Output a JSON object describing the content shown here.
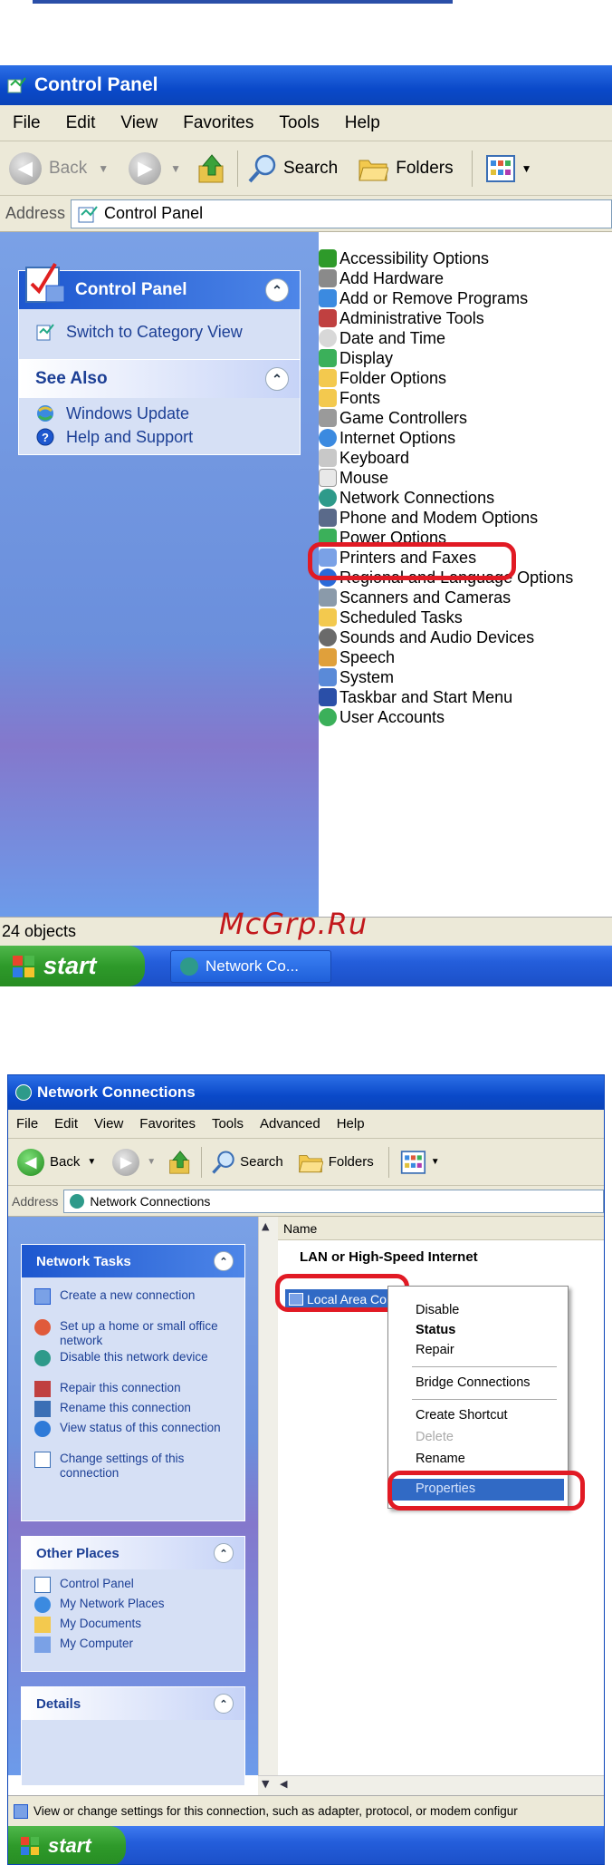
{
  "window1": {
    "title": "Control Panel",
    "menu": [
      "File",
      "Edit",
      "View",
      "Favorites",
      "Tools",
      "Help"
    ],
    "toolbar": {
      "back": "Back",
      "search": "Search",
      "folders": "Folders"
    },
    "address_label": "Address",
    "address_value": "Control Panel",
    "control_panel_box": {
      "title": "Control Panel",
      "link": "Switch to Category View"
    },
    "see_also_box": {
      "title": "See Also",
      "links": [
        "Windows Update",
        "Help and Support"
      ]
    },
    "items": [
      "Accessibility Options",
      "Add Hardware",
      "Add or Remove Programs",
      "Administrative Tools",
      "Date and Time",
      "Display",
      "Folder Options",
      "Fonts",
      "Game Controllers",
      "Internet Options",
      "Keyboard",
      "Mouse",
      "Network Connections",
      "Phone and Modem Options",
      "Power Options",
      "Printers and Faxes",
      "Regional and Language Options",
      "Scanners and Cameras",
      "Scheduled Tasks",
      "Sounds and Audio Devices",
      "Speech",
      "System",
      "Taskbar and Start Menu",
      "User Accounts"
    ],
    "status": "24 objects",
    "taskbar": {
      "start": "start",
      "task": "Network Co..."
    },
    "watermark": "McGrp.Ru"
  },
  "window2": {
    "title": "Network Connections",
    "menu": [
      "File",
      "Edit",
      "View",
      "Favorites",
      "Tools",
      "Advanced",
      "Help"
    ],
    "toolbar": {
      "back": "Back",
      "search": "Search",
      "folders": "Folders"
    },
    "address_label": "Address",
    "address_value": "Network Connections",
    "network_tasks": {
      "title": "Network Tasks",
      "links": [
        "Create a new connection",
        "Set up a home or small office network",
        "Disable this network device",
        "Repair this connection",
        "Rename this connection",
        "View status of this connection",
        "Change settings of this connection"
      ]
    },
    "other_places": {
      "title": "Other Places",
      "links": [
        "Control Panel",
        "My Network Places",
        "My Documents",
        "My Computer"
      ]
    },
    "details": {
      "title": "Details"
    },
    "column_header": "Name",
    "group_header": "LAN or High-Speed Internet",
    "connection_item": "Local Area Con",
    "context_menu": [
      "Disable",
      "Status",
      "Repair",
      "Bridge Connections",
      "Create Shortcut",
      "Delete",
      "Rename",
      "Properties"
    ],
    "status": "View or change settings for this connection, such as adapter, protocol, or modem configur",
    "taskbar": {
      "start": "start"
    }
  }
}
